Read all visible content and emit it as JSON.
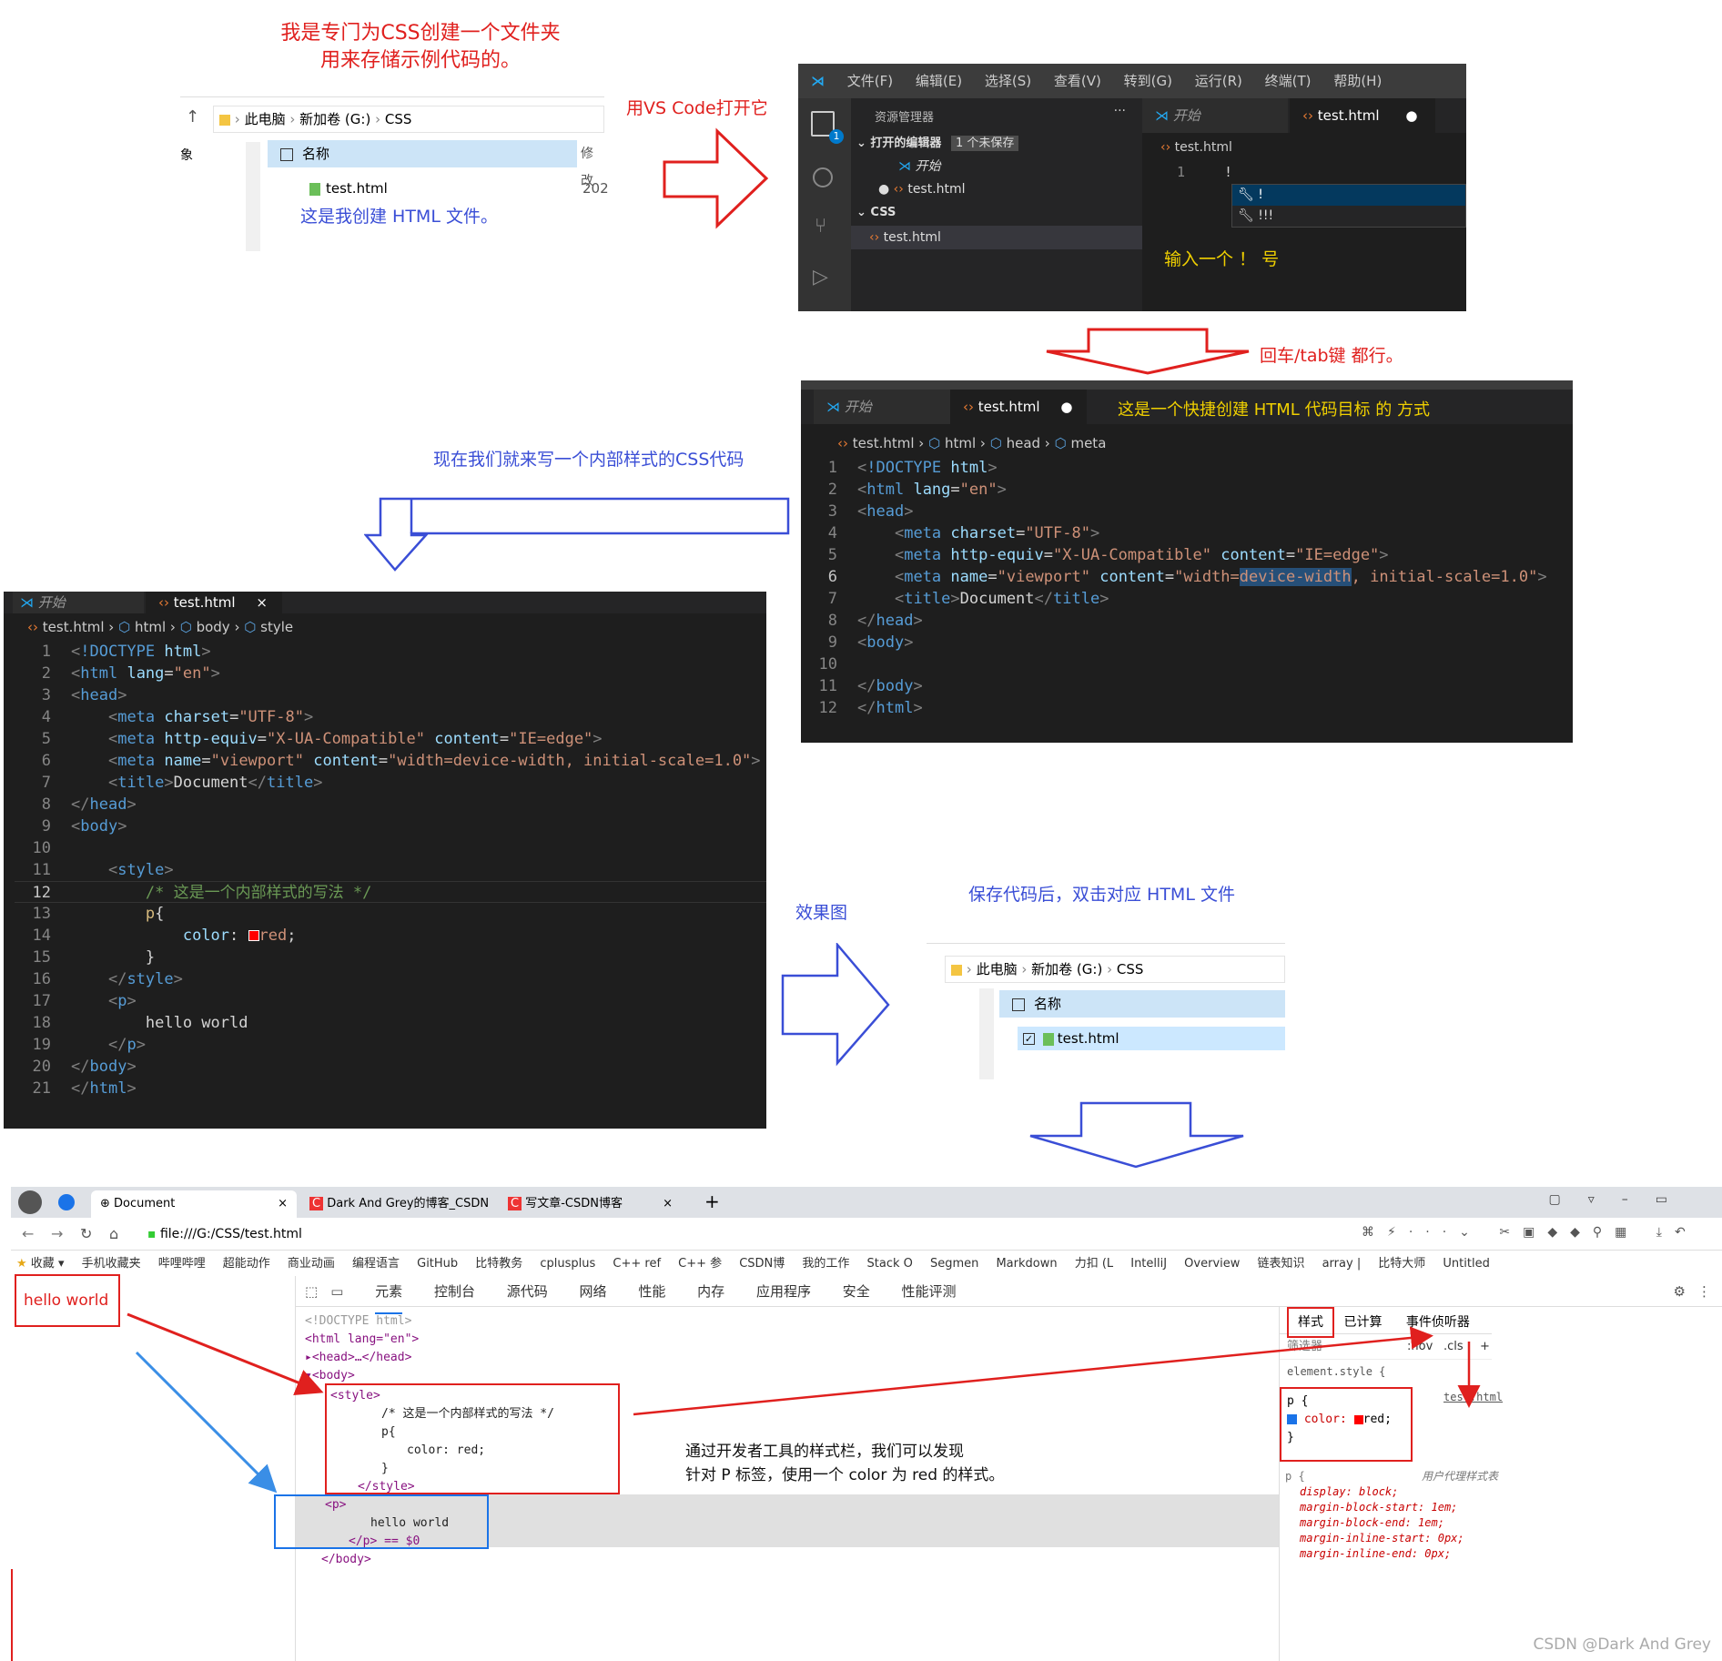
{
  "annotations": {
    "folder_note_1": "我是专门为CSS创建一个文件夹",
    "folder_note_2": "用来存储示例代码的。",
    "open_vscode": "用VS Code打开它",
    "html_note": "这是我创建 HTML 文件。",
    "type_bang": "输入一个 ！ 号",
    "enter_tab": "回车/tab键 都行。",
    "quick_html": "这是一个快捷创建 HTML 代码目标 的 方式",
    "write_css": "现在我们就来写一个内部样式的CSS代码",
    "effect": "效果图",
    "save_open": "保存代码后，双击对应 HTML 文件",
    "devtools_note_1": "通过开发者工具的样式栏，我们可以发现",
    "devtools_note_2": "针对 P 标签，使用一个 color 为 red 的样式。",
    "watermark": "CSDN @Dark And Grey"
  },
  "explorer1": {
    "path": [
      "此电脑",
      "新加卷 (G:)",
      "CSS"
    ],
    "col_name": "名称",
    "col_modified": "修改",
    "file": "test.html",
    "date": "202",
    "side": "象"
  },
  "vscode1": {
    "menu": [
      "文件(F)",
      "编辑(E)",
      "选择(S)",
      "查看(V)",
      "转到(G)",
      "运行(R)",
      "终端(T)",
      "帮助(H)"
    ],
    "explorer_title": "资源管理器",
    "open_editors": "打开的编辑器",
    "unsaved": "1 个未保存",
    "start": "开始",
    "test_html": "test.html",
    "css_folder": "CSS",
    "tab_start": "开始",
    "tab_test": "test.html",
    "breadcrumb": "test.html",
    "line_no": "1",
    "typed": "!",
    "suggest_1": "!",
    "suggest_2": "!!!",
    "badge": "1"
  },
  "vscode2": {
    "tab_start": "开始",
    "tab_test": "test.html",
    "breadcrumb": [
      "test.html",
      "html",
      "head",
      "meta"
    ]
  },
  "vscode3": {
    "tab_start": "开始",
    "tab_test": "test.html",
    "breadcrumb": [
      "test.html",
      "html",
      "body",
      "style"
    ]
  },
  "explorer2": {
    "path": [
      "此电脑",
      "新加卷 (G:)",
      "CSS"
    ],
    "col_name": "名称",
    "file": "test.html"
  },
  "browser": {
    "tabs": [
      "Document",
      "Dark And Grey的博客_CSDN",
      "写文章-CSDN博客"
    ],
    "url": "file:///G:/CSS/test.html",
    "bookmarks": [
      "收藏",
      "手机收藏夹",
      "哔哩哔哩",
      "超能动作",
      "商业动画",
      "编程语言",
      "GitHub",
      "比特教务",
      "cplusplus",
      "C++ ref",
      "C++ 参",
      "CSDN博",
      "我的工作",
      "Stack O",
      "Segmen",
      "Markdown",
      "力扣 (L",
      "IntelliJ",
      "Overview",
      "链表知识",
      "array |",
      "比特大师",
      "Untitled"
    ],
    "page_text": "hello world",
    "devtools_tabs": [
      "元素",
      "控制台",
      "源代码",
      "网络",
      "性能",
      "内存",
      "应用程序",
      "安全",
      "性能评测"
    ],
    "styles_tabs": [
      "样式",
      "已计算",
      "事件侦听器"
    ],
    "filter": "筛选器",
    "hov": ":hov",
    "cls": ".cls",
    "element_style": "element.style {",
    "rule_selector": "p {",
    "rule_prop": "color:",
    "rule_val": "red;",
    "rule_close": "}",
    "rule_src": "test.html",
    "ua_selector": "p {",
    "ua_label": "用户代理样式表",
    "ua_props": [
      "display: block;",
      "margin-block-start: 1em;",
      "margin-block-end: 1em;",
      "margin-inline-start: 0px;",
      "margin-inline-end: 0px;"
    ],
    "dom": [
      "<!DOCTYPE html>",
      "<html lang=\"en\">",
      "<head>…</head>",
      "<body>",
      "<style>",
      "/* 这是一个内部样式的写法 */",
      "p{",
      "color: red;",
      "}",
      "</style>",
      "<p>",
      "hello world",
      "</p> == $0",
      "</body>"
    ]
  },
  "colors": {
    "red_note": "#e0201e",
    "blue_note": "#3a4ed6",
    "vs_bg": "#1e1e1e",
    "accent": "#007acc"
  }
}
